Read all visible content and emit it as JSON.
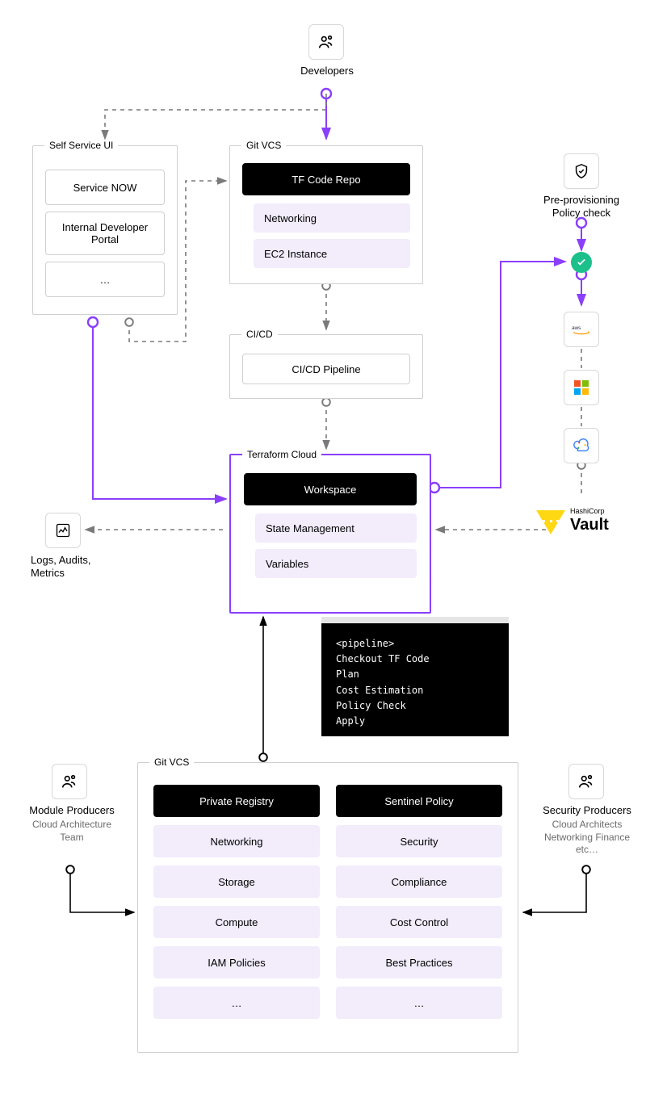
{
  "roles": {
    "developers": "Developers",
    "module_producers_title": "Module Producers",
    "module_producers_sub": "Cloud Architecture Team",
    "security_producers_title": "Security Producers",
    "security_producers_sub": "Cloud Architects Networking Finance etc…"
  },
  "self_service": {
    "legend": "Self Service UI",
    "items": [
      "Service NOW",
      "Internal Developer Portal",
      "…"
    ]
  },
  "git_vcs_top": {
    "legend": "Git VCS",
    "header": "TF Code Repo",
    "items": [
      "Networking",
      "EC2 Instance"
    ]
  },
  "cicd": {
    "legend": "CI/CD",
    "item": "CI/CD Pipeline"
  },
  "tf_cloud": {
    "legend": "Terraform Cloud",
    "header": "Workspace",
    "items": [
      "State Management",
      "Variables"
    ]
  },
  "policy_check": {
    "label": "Pre-provisioning Policy check"
  },
  "clouds": [
    "aws",
    "azure",
    "gcp"
  ],
  "vault": {
    "brand": "HashiCorp",
    "name": "Vault"
  },
  "logs_label": "Logs, Audits, Metrics",
  "terminal": {
    "lines": [
      "<pipeline>",
      "Checkout TF Code",
      "Plan",
      "Cost Estimation",
      "Policy Check",
      "Apply"
    ]
  },
  "git_vcs_bottom": {
    "legend": "Git VCS",
    "private_registry": {
      "header": "Private Registry",
      "items": [
        "Networking",
        "Storage",
        "Compute",
        "IAM Policies",
        "…"
      ]
    },
    "sentinel": {
      "header": "Sentinel Policy",
      "items": [
        "Security",
        "Compliance",
        "Cost Control",
        "Best Practices",
        "…"
      ]
    }
  }
}
